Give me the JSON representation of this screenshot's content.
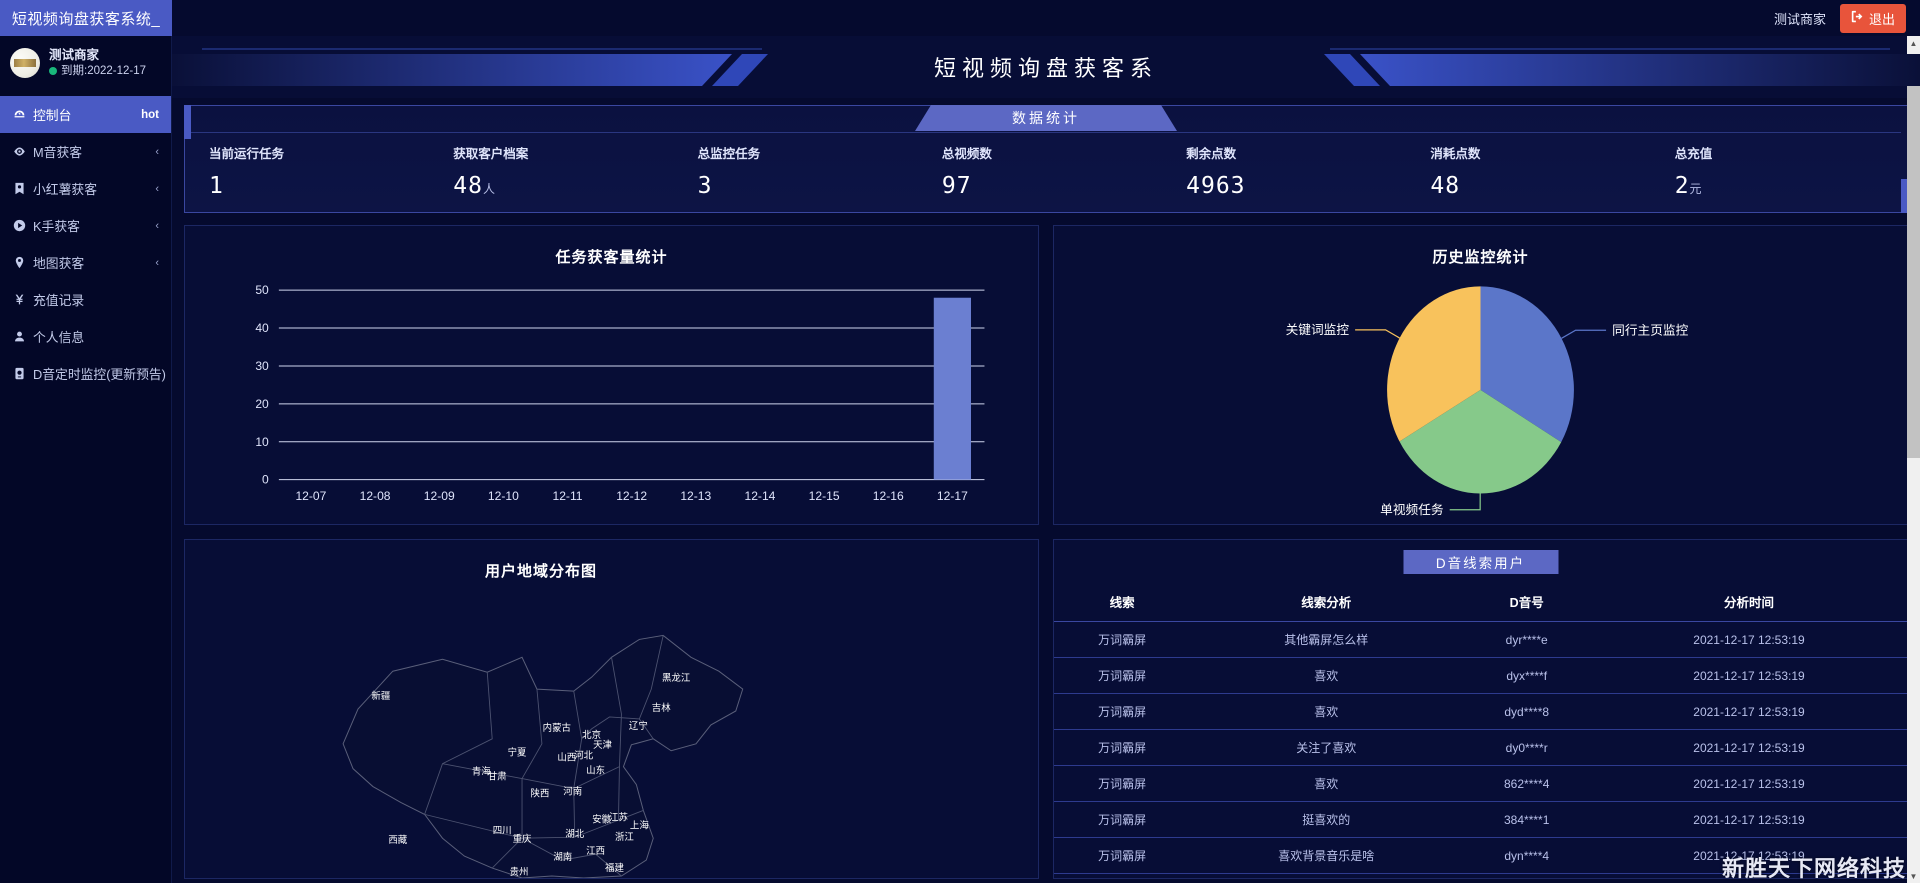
{
  "window": {
    "tab_title": "短视频询盘获客系统_",
    "merchant": "测试商家",
    "logout_label": "退出"
  },
  "sidebar": {
    "profile": {
      "name": "测试商家",
      "expiry": "到期:2022-12-17"
    },
    "items": [
      {
        "label": "控制台",
        "icon": "dashboard-icon",
        "badge": "hot",
        "active": true,
        "chevron": ""
      },
      {
        "label": "M音获客",
        "icon": "eye-icon",
        "badge": "",
        "active": false,
        "chevron": "‹"
      },
      {
        "label": "小红薯获客",
        "icon": "book-icon",
        "badge": "",
        "active": false,
        "chevron": "‹"
      },
      {
        "label": "K手获客",
        "icon": "play-icon",
        "badge": "",
        "active": false,
        "chevron": "‹"
      },
      {
        "label": "地图获客",
        "icon": "map-pin-icon",
        "badge": "",
        "active": false,
        "chevron": "‹"
      },
      {
        "label": "充值记录",
        "icon": "yuan-icon",
        "badge": "",
        "active": false,
        "chevron": ""
      },
      {
        "label": "个人信息",
        "icon": "user-icon",
        "badge": "",
        "active": false,
        "chevron": ""
      },
      {
        "label": "D音定时监控(更新预告)",
        "icon": "clock-monitor-icon",
        "badge": "",
        "active": false,
        "chevron": ""
      }
    ]
  },
  "banner": {
    "title": "短视频询盘获客系"
  },
  "stats": {
    "tab_label": "数据统计",
    "items": [
      {
        "label": "当前运行任务",
        "value": "1",
        "unit": ""
      },
      {
        "label": "获取客户档案",
        "value": "48",
        "unit": "人"
      },
      {
        "label": "总监控任务",
        "value": "3",
        "unit": ""
      },
      {
        "label": "总视频数",
        "value": "97",
        "unit": ""
      },
      {
        "label": "剩余点数",
        "value": "4963",
        "unit": ""
      },
      {
        "label": "消耗点数",
        "value": "48",
        "unit": ""
      },
      {
        "label": "总充值",
        "value": "2",
        "unit": "元"
      }
    ]
  },
  "chart_data": [
    {
      "type": "bar",
      "title": "任务获客量统计",
      "categories": [
        "12-07",
        "12-08",
        "12-09",
        "12-10",
        "12-11",
        "12-12",
        "12-13",
        "12-14",
        "12-15",
        "12-16",
        "12-17"
      ],
      "values": [
        0,
        0,
        0,
        0,
        0,
        0,
        0,
        0,
        0,
        0,
        48
      ],
      "xlabel": "",
      "ylabel": "",
      "ylim": [
        0,
        50
      ],
      "yticks": [
        0,
        10,
        20,
        30,
        40,
        50
      ],
      "grid": true,
      "series_color": "#6b7fd1",
      "legend": "none"
    },
    {
      "type": "pie",
      "title": "历史监控统计",
      "labels": [
        "同行主页监控",
        "单视频任务",
        "关键词监控"
      ],
      "values": [
        33.4,
        33.3,
        33.3
      ],
      "colors": [
        "#5b76c9",
        "#86c98a",
        "#f8c25c"
      ],
      "legend": "labels-outside"
    },
    {
      "type": "map",
      "title": "用户地域分布图",
      "regions": [
        "新疆",
        "黑龙江",
        "吉林",
        "辽宁",
        "内蒙古",
        "北京",
        "天津",
        "宁夏",
        "山西",
        "河北",
        "青海",
        "甘肃",
        "山东",
        "陕西",
        "河南",
        "安徽",
        "江苏",
        "上海",
        "四川",
        "重庆",
        "湖北",
        "浙江",
        "西藏",
        "湖南",
        "江西",
        "贵州",
        "福建"
      ],
      "values": []
    }
  ],
  "leads": {
    "tab_label": "D音线索用户",
    "columns": [
      "线索",
      "线索分析",
      "D音号",
      "分析时间"
    ],
    "rows": [
      [
        "万词霸屏",
        "其他霸屏怎么样",
        "dyr****e",
        "2021-12-17 12:53:19"
      ],
      [
        "万词霸屏",
        "喜欢",
        "dyx****f",
        "2021-12-17 12:53:19"
      ],
      [
        "万词霸屏",
        "喜欢",
        "dyd****8",
        "2021-12-17 12:53:19"
      ],
      [
        "万词霸屏",
        "关注了喜欢",
        "dy0****r",
        "2021-12-17 12:53:19"
      ],
      [
        "万词霸屏",
        "喜欢",
        "862****4",
        "2021-12-17 12:53:19"
      ],
      [
        "万词霸屏",
        "挺喜欢的",
        "384****1",
        "2021-12-17 12:53:19"
      ],
      [
        "万词霸屏",
        "喜欢背景音乐是啥",
        "dyn****4",
        "2021-12-17 12:53:19"
      ]
    ]
  },
  "watermark": "新胜天下网络科技",
  "colors": {
    "accent": "#4a5ac4",
    "danger": "#e8543b",
    "background": "#050a2e",
    "panel": "#070d36",
    "bar": "#6b7fd1",
    "pie_blue": "#5b76c9",
    "pie_green": "#86c98a",
    "pie_yellow": "#f8c25c"
  }
}
